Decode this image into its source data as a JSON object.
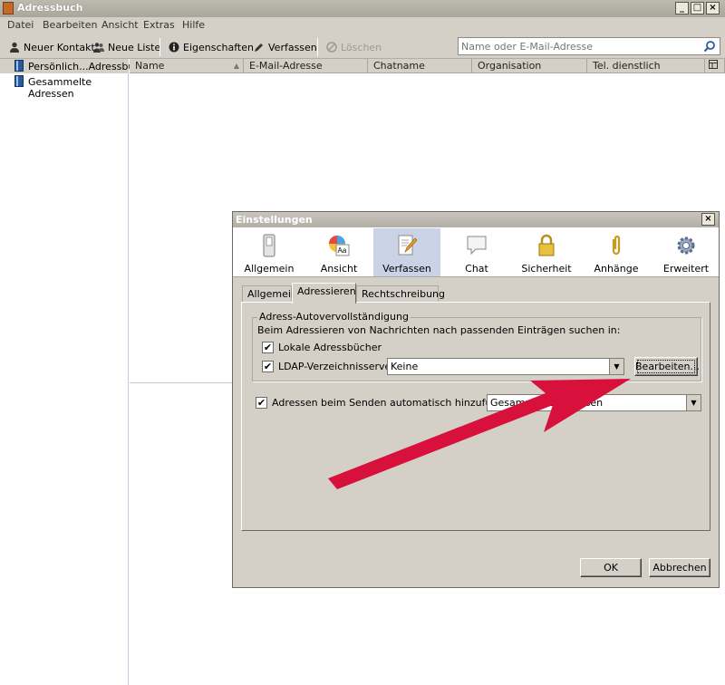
{
  "window": {
    "title": "Adressbuch"
  },
  "menu": [
    "Datei",
    "Bearbeiten",
    "Ansicht",
    "Extras",
    "Hilfe"
  ],
  "toolbar": {
    "new_contact": "Neuer Kontakt",
    "new_list": "Neue Liste",
    "properties": "Eigenschaften",
    "compose": "Verfassen",
    "delete": "Löschen"
  },
  "search": {
    "placeholder": "Name oder E-Mail-Adresse"
  },
  "addressbooks": [
    "Persönlich...Adressbuch",
    "Gesammelte Adressen"
  ],
  "columns": [
    "Name",
    "E-Mail-Adresse",
    "Chatname",
    "Organisation",
    "Tel. dienstlich"
  ],
  "dialog": {
    "title": "Einstellungen",
    "panes": [
      "Allgemein",
      "Ansicht",
      "Verfassen",
      "Chat",
      "Sicherheit",
      "Anhänge",
      "Erweitert"
    ],
    "tabs": [
      "Allgemein",
      "Adressieren",
      "Rechtschreibung"
    ],
    "group_legend": "Adress-Autovervollständigung",
    "group_desc": "Beim Adressieren von Nachrichten nach passenden Einträgen suchen in:",
    "local_books": "Lokale Adressbücher",
    "ldap_label": "LDAP-Verzeichnisserver:",
    "ldap_value": "Keine",
    "edit_button": "Bearbeiten...",
    "auto_add_label": "Adressen beim Senden automatisch hinzufügen zu:",
    "auto_add_value": "Gesammelte Adressen",
    "ok": "OK",
    "cancel": "Abbrechen"
  },
  "colors": {
    "arrow": "#d8103c",
    "selected_pane": "#cad3e6"
  }
}
